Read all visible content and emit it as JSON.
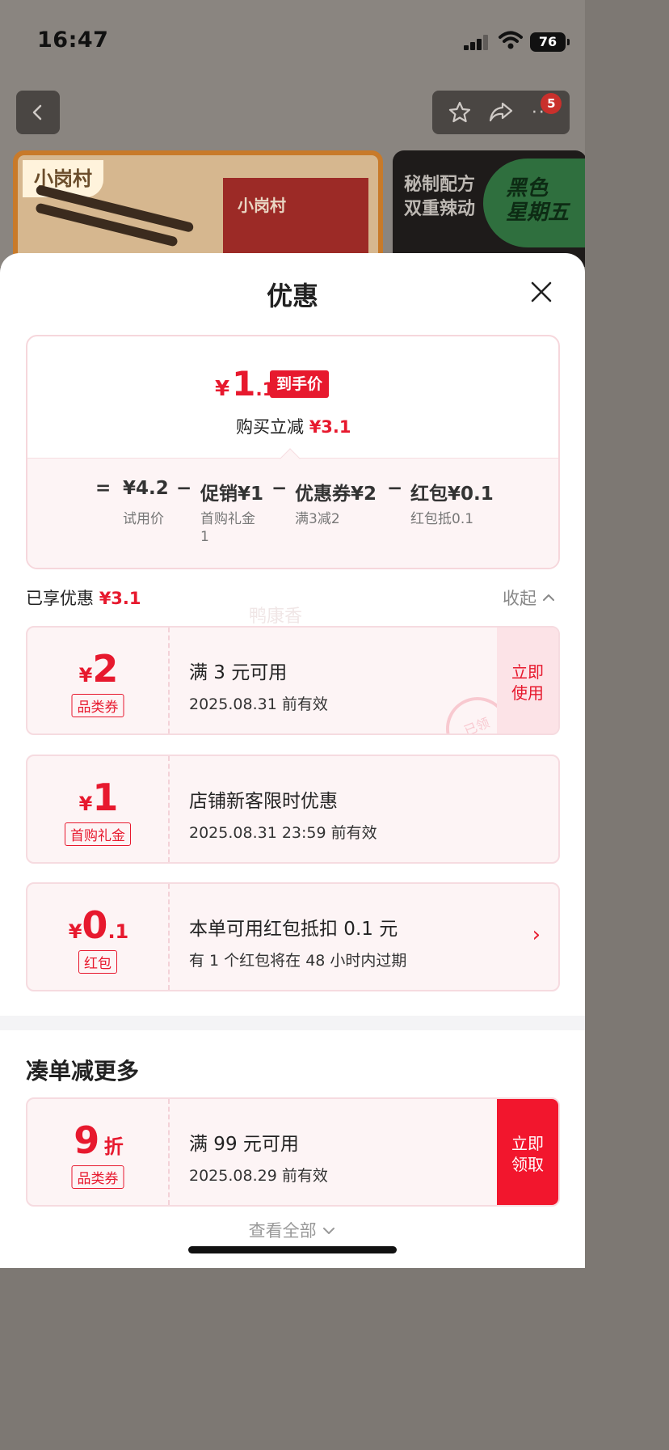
{
  "status_bar": {
    "time": "16:47",
    "battery": "76"
  },
  "nav": {
    "cart_badge": "5"
  },
  "background": {
    "brand_label": "小岗村",
    "pack_text": "小岗村",
    "promo_text_line1": "秘制配方",
    "promo_text_line2": "双重辣动",
    "black_friday_line1": "黑色",
    "black_friday_line2": "星期五"
  },
  "sheet": {
    "title": "优惠",
    "final_price": {
      "currency": "¥",
      "integer": "1",
      "decimal": ".1",
      "tag": "到手价"
    },
    "saving": {
      "label": "购买立减",
      "value": "¥3.1"
    },
    "formula": {
      "equals": "=",
      "trial_price": "¥4.2",
      "trial_label": "试用价",
      "promo": "促销¥1",
      "promo_sub": "首购礼金\n1",
      "coupon": "优惠券¥2",
      "coupon_sub": "满3减2",
      "redpack": "红包¥0.1",
      "redpack_sub": "红包抵0.1",
      "minus": "−"
    },
    "enjoyed": {
      "label": "已享优惠",
      "value": "¥3.1"
    },
    "collapse_label": "收起",
    "watermark": "鸭康香",
    "coupons": [
      {
        "currency": "¥",
        "amount": "2",
        "decimal": "",
        "kind": "品类券",
        "title": "满 3 元可用",
        "sub": "2025.08.31 前有效",
        "action": "立即\n使用",
        "stamp": "已领"
      },
      {
        "currency": "¥",
        "amount": "1",
        "decimal": "",
        "kind": "首购礼金",
        "title": "店铺新客限时优惠",
        "sub": "2025.08.31 23:59 前有效"
      },
      {
        "currency": "¥",
        "amount": "0",
        "decimal": ".1",
        "kind": "红包",
        "title": "本单可用红包抵扣 0.1 元",
        "sub": "有 1 个红包将在 48 小时内过期",
        "arrow": "›"
      }
    ],
    "more_section": {
      "title": "凑单减更多",
      "coupon": {
        "amount": "9",
        "unit": "折",
        "kind": "品类券",
        "title": "满 99 元可用",
        "sub": "2025.08.29 前有效",
        "action": "立即\n领取"
      }
    },
    "view_all": "查看全部"
  },
  "colors": {
    "accent_red": "#e7192e",
    "coupon_bg": "#fdf4f5"
  }
}
